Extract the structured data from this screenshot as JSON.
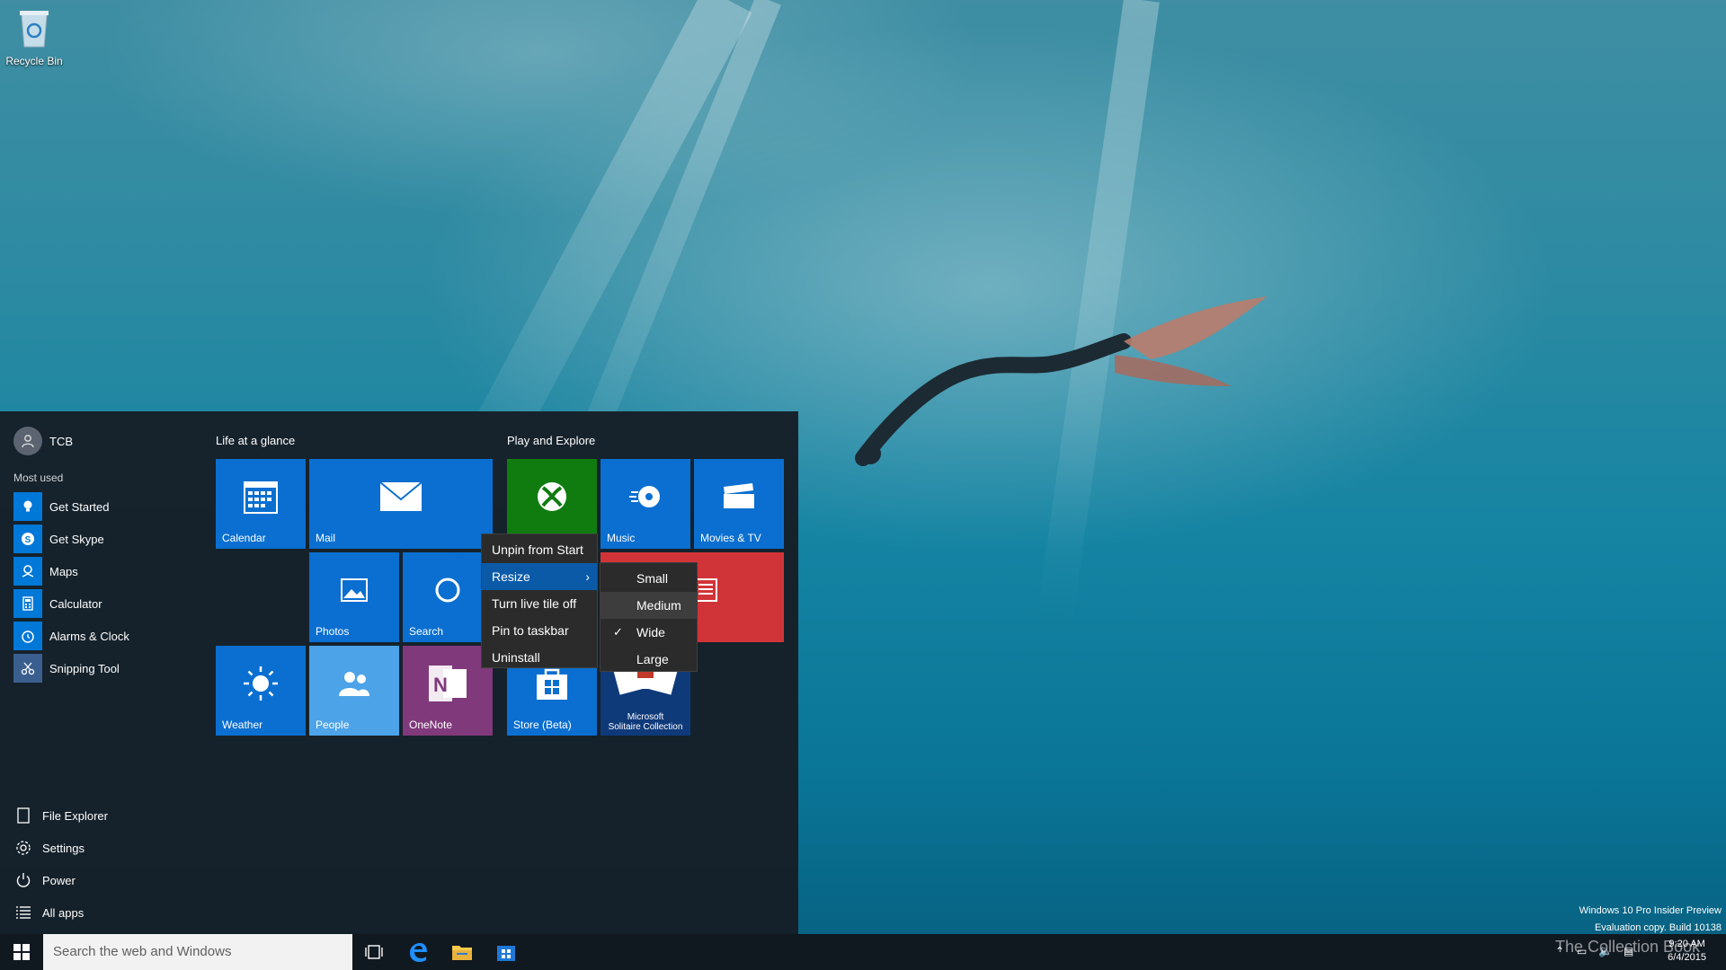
{
  "desktop": {
    "recycle_bin_label": "Recycle Bin",
    "build_line1": "Windows 10 Pro Insider Preview",
    "build_line2": "Evaluation copy. Build 10138",
    "watermark": "The Collection Book"
  },
  "start_menu": {
    "user_name": "TCB",
    "most_used_label": "Most used",
    "most_used": [
      {
        "label": "Get Started",
        "icon": "lightbulb-icon"
      },
      {
        "label": "Get Skype",
        "icon": "skype-icon"
      },
      {
        "label": "Maps",
        "icon": "maps-icon"
      },
      {
        "label": "Calculator",
        "icon": "calculator-icon"
      },
      {
        "label": "Alarms & Clock",
        "icon": "alarm-clock-icon"
      },
      {
        "label": "Snipping Tool",
        "icon": "scissors-icon"
      }
    ],
    "bottom": [
      {
        "label": "File Explorer",
        "icon": "file-explorer-icon"
      },
      {
        "label": "Settings",
        "icon": "gear-icon"
      },
      {
        "label": "Power",
        "icon": "power-icon"
      },
      {
        "label": "All apps",
        "icon": "list-icon"
      }
    ],
    "groups": {
      "life": "Life at a glance",
      "play": "Play and Explore"
    },
    "tiles": {
      "calendar": "Calendar",
      "mail": "Mail",
      "photos": "Photos",
      "search": "Search",
      "weather": "Weather",
      "people": "People",
      "onenote": "OneNote",
      "music": "Music",
      "movies": "Movies & TV",
      "store": "Store (Beta)",
      "solitaire_line1": "Microsoft",
      "solitaire_line2": "Solitaire Collection"
    },
    "colors": {
      "tile_blue": "#0a6fd0",
      "xbox_green": "#107c10",
      "news_red": "#d13438",
      "people_light": "#4ca3e8",
      "onenote_purple": "#80397b"
    }
  },
  "context_menu": {
    "items": [
      "Unpin from Start",
      "Resize",
      "Turn live tile off",
      "Pin to taskbar",
      "Uninstall"
    ],
    "submenu": [
      "Small",
      "Medium",
      "Wide",
      "Large"
    ],
    "checked": "Wide"
  },
  "taskbar": {
    "search_placeholder": "Search the web and Windows",
    "time": "9:20 AM",
    "date": "6/4/2015"
  }
}
